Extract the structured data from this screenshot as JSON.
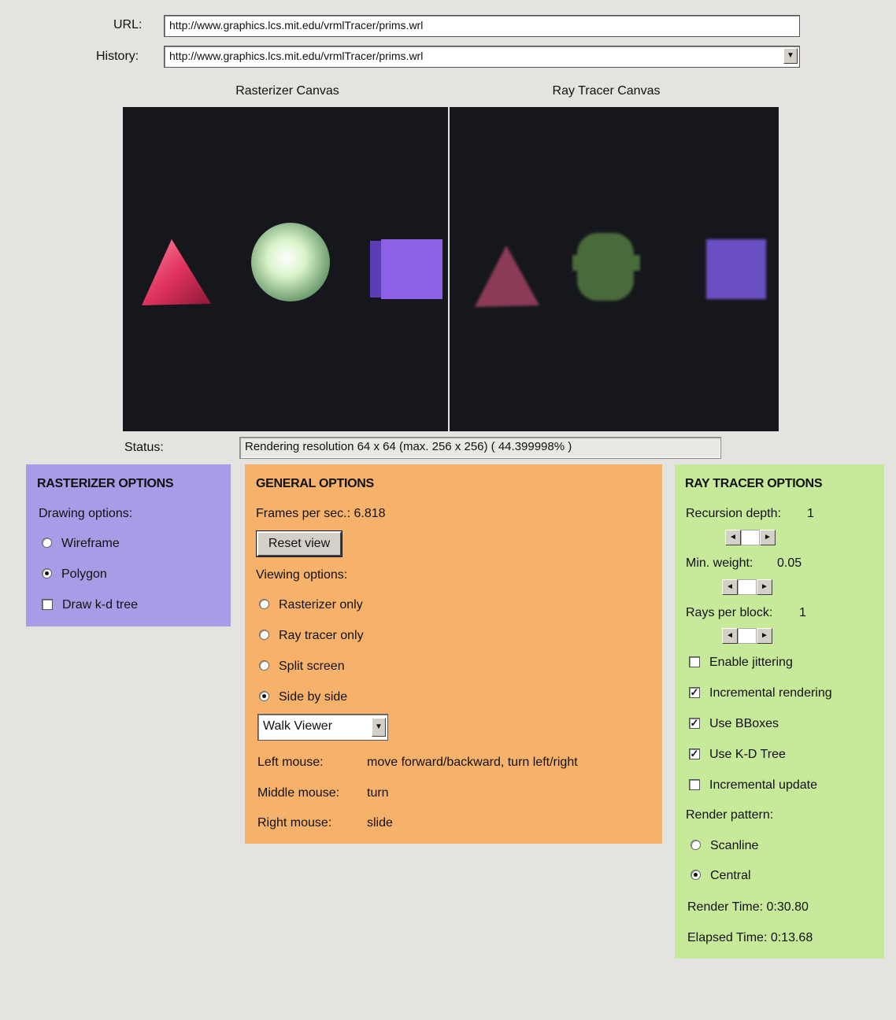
{
  "header": {
    "url_label": "URL:",
    "url_value": "http://www.graphics.lcs.mit.edu/vrmlTracer/prims.wrl",
    "history_label": "History:",
    "history_value": "http://www.graphics.lcs.mit.edu/vrmlTracer/prims.wrl"
  },
  "canvases": {
    "rasterizer_title": "Rasterizer Canvas",
    "raytracer_title": "Ray Tracer Canvas"
  },
  "status": {
    "label": "Status:",
    "value": "Rendering resolution 64 x 64 (max. 256 x 256) ( 44.399998% )"
  },
  "rasterizer_options": {
    "title": "RASTERIZER OPTIONS",
    "drawing_label": "Drawing options:",
    "wireframe": "Wireframe",
    "polygon": "Polygon",
    "draw_kd": "Draw k-d tree"
  },
  "general_options": {
    "title": "GENERAL OPTIONS",
    "fps": "Frames per sec.: 6.818",
    "reset_view": "Reset view",
    "viewing_label": "Viewing options:",
    "rasterizer_only": "Rasterizer only",
    "raytracer_only": "Ray tracer only",
    "split_screen": "Split screen",
    "side_by_side": "Side by side",
    "viewer_select": "Walk Viewer",
    "mouse": [
      {
        "label": "Left mouse:",
        "action": "move forward/backward, turn left/right"
      },
      {
        "label": "Middle mouse:",
        "action": "turn"
      },
      {
        "label": "Right mouse:",
        "action": "slide"
      }
    ]
  },
  "raytracer_options": {
    "title": "RAY TRACER OPTIONS",
    "recursion_label": "Recursion depth:",
    "recursion_value": "1",
    "min_weight_label": "Min. weight:",
    "min_weight_value": "0.05",
    "rays_label": "Rays per block:",
    "rays_value": "1",
    "enable_jittering": "Enable jittering",
    "incremental_rendering": "Incremental rendering",
    "use_bboxes": "Use BBoxes",
    "use_kd_tree": "Use K-D Tree",
    "incremental_update": "Incremental update",
    "render_pattern_label": "Render pattern:",
    "scanline": "Scanline",
    "central": "Central",
    "render_time": "Render Time: 0:30.80",
    "elapsed_time": "Elapsed Time: 0:13.68"
  },
  "colors": {
    "rasterizer_panel": "#a99ce6",
    "general_panel": "#f6b26b",
    "raytracer_panel": "#c7e99a"
  }
}
